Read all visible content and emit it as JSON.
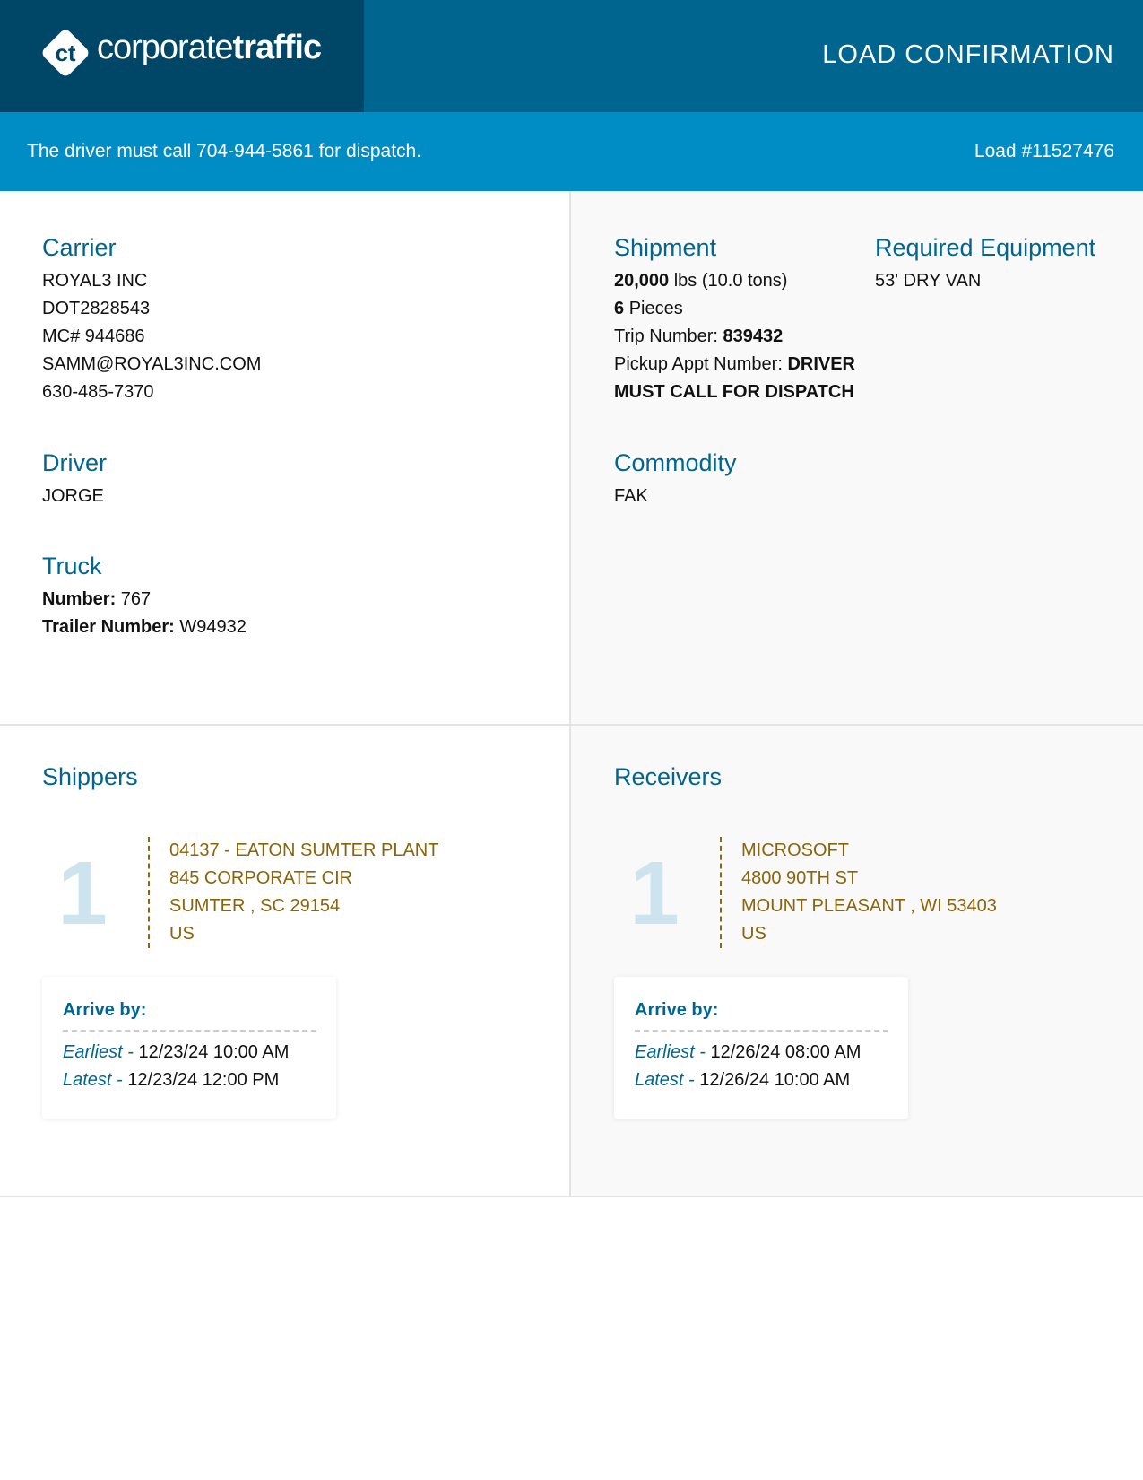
{
  "header": {
    "logo_initials": "ct",
    "logo_light": "corporate",
    "logo_bold": "traffic",
    "title": "LOAD CONFIRMATION"
  },
  "banner": {
    "message": "The driver must call 704-944-5861 for dispatch.",
    "load": "Load #11527476"
  },
  "carrier": {
    "title": "Carrier",
    "name": "ROYAL3 INC",
    "dot": "DOT2828543",
    "mc": "MC# 944686",
    "email": "SAMM@ROYAL3INC.COM",
    "phone": "630-485-7370"
  },
  "driver": {
    "title": "Driver",
    "name": "JORGE"
  },
  "truck": {
    "title": "Truck",
    "number_label": "Number:",
    "number": "767",
    "trailer_label": "Trailer Number:",
    "trailer": "W94932"
  },
  "shipment": {
    "title": "Shipment",
    "weight": "20,000",
    "weight_unit": "lbs (10.0 tons)",
    "pieces": "6",
    "pieces_label": "Pieces",
    "trip_label": "Trip Number:",
    "trip": "839432",
    "appt_label": "Pickup Appt Number:",
    "appt_line1": "DRIVER",
    "appt_line2": "MUST CALL FOR DISPATCH"
  },
  "equipment": {
    "title": "Required Equipment",
    "value": "53' DRY VAN"
  },
  "commodity": {
    "title": "Commodity",
    "value": "FAK"
  },
  "shippers": {
    "title": "Shippers",
    "stop_number": "1",
    "address": [
      "04137 - EATON SUMTER PLANT",
      "845 CORPORATE CIR",
      "SUMTER , SC 29154",
      "US"
    ],
    "arrive_title": "Arrive by:",
    "earliest_label": "Earliest -",
    "earliest": "12/23/24 10:00 AM",
    "latest_label": "Latest -",
    "latest": "12/23/24 12:00 PM"
  },
  "receivers": {
    "title": "Receivers",
    "stop_number": "1",
    "address": [
      "MICROSOFT",
      "4800 90TH ST",
      "MOUNT PLEASANT , WI 53403",
      "US"
    ],
    "arrive_title": "Arrive by:",
    "earliest_label": "Earliest -",
    "earliest": "12/26/24 08:00 AM",
    "latest_label": "Latest -",
    "latest": "12/26/24 10:00 AM"
  }
}
